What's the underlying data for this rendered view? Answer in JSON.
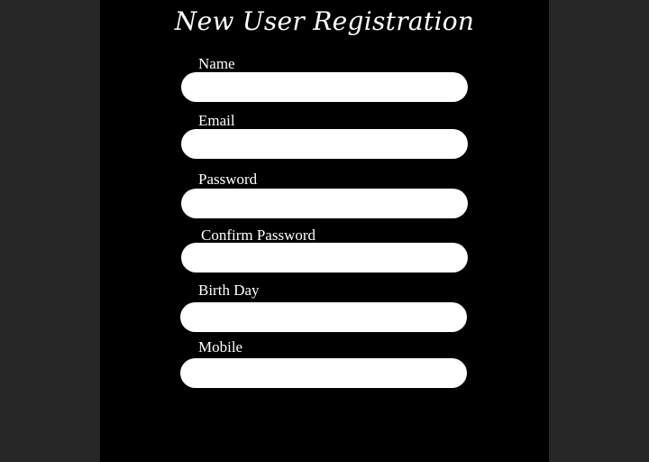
{
  "form": {
    "title": "New User Registration",
    "fields": [
      {
        "label": "Name",
        "value": "",
        "type": "text"
      },
      {
        "label": "Email",
        "value": "",
        "type": "email"
      },
      {
        "label": "Password",
        "value": "",
        "type": "password"
      },
      {
        "label": "Confirm Password",
        "value": "",
        "type": "password"
      },
      {
        "label": "Birth Day",
        "value": "",
        "type": "text"
      },
      {
        "label": "Mobile",
        "value": "",
        "type": "tel"
      }
    ]
  },
  "colors": {
    "outer_background": "#262626",
    "panel_background": "#000000",
    "text": "#ffffff",
    "field_background": "#ffffff"
  }
}
